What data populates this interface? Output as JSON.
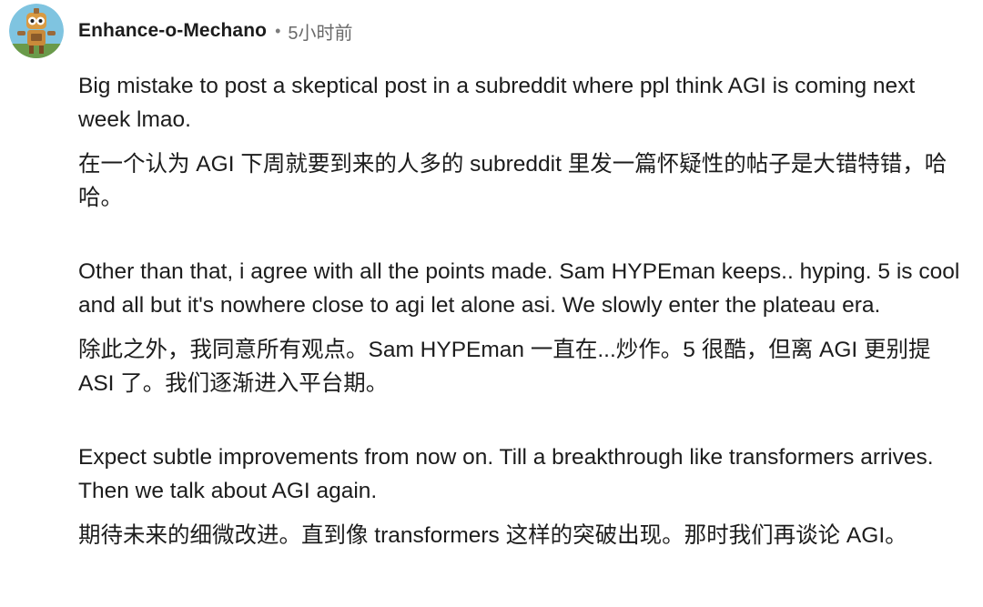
{
  "comment": {
    "author": "Enhance-o-Mechano",
    "separator": "•",
    "timestamp": "5小时前",
    "avatar_icon": "robot-avatar-icon",
    "paragraphs": [
      {
        "en": "Big mistake to post a skeptical post in a subreddit where ppl think AGI is coming next week lmao.",
        "zh": "在一个认为 AGI 下周就要到来的人多的 subreddit 里发一篇怀疑性的帖子是大错特错，哈哈。"
      },
      {
        "en": "Other than that, i agree with all the points made. Sam HYPEman keeps.. hyping. 5 is cool and all but it's nowhere close to agi let alone asi. We slowly enter the plateau era.",
        "zh": "除此之外，我同意所有观点。Sam HYPEman 一直在...炒作。5 很酷，但离 AGI 更别提 ASI 了。我们逐渐进入平台期。"
      },
      {
        "en": "Expect subtle improvements from now on. Till a breakthrough like transformers arrives. Then we talk about AGI again.",
        "zh": "期待未来的细微改进。直到像 transformers 这样的突破出现。那时我们再谈论 AGI。"
      }
    ]
  },
  "colors": {
    "text": "#1c1c1c",
    "muted": "#6a6a6a",
    "avatar_bg": "#7fc4e0"
  }
}
